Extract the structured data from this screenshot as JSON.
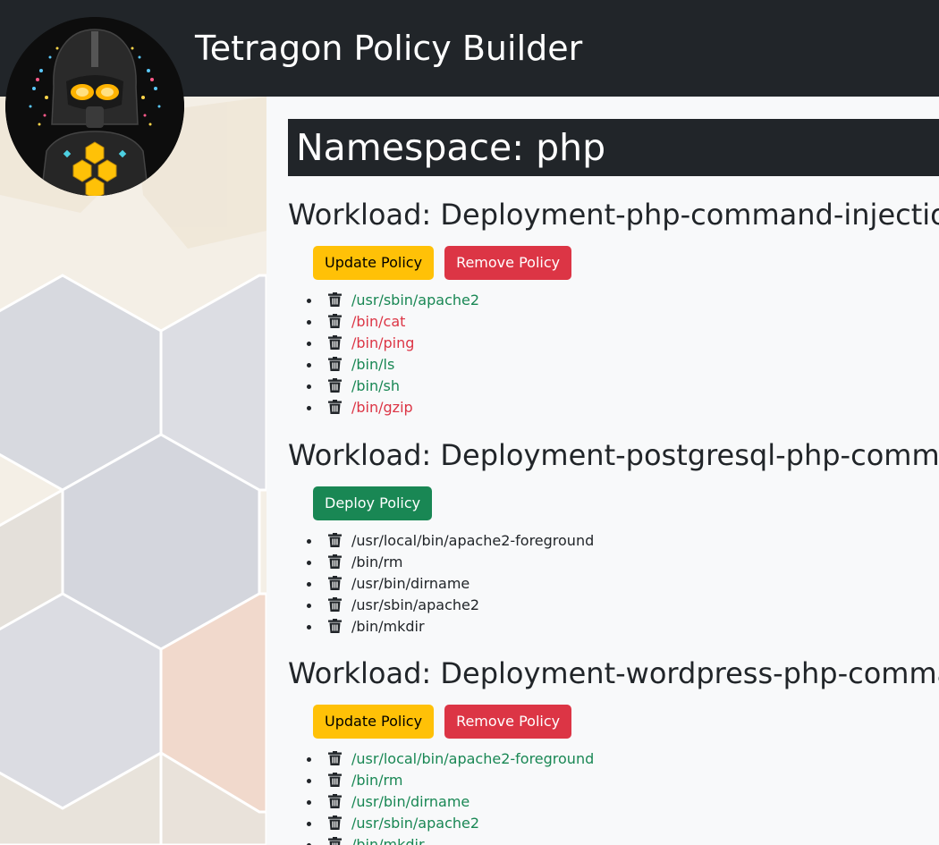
{
  "navbar": {
    "brand": "Tetragon Policy Builder"
  },
  "namespace": {
    "title": "Namespace: php"
  },
  "workloads": [
    {
      "title": "Workload: Deployment-php-command-injection",
      "buttons": [
        {
          "label": "Update Policy",
          "variant": "warning"
        },
        {
          "label": "Remove Policy",
          "variant": "danger"
        }
      ],
      "binaries": [
        {
          "path": "/usr/sbin/apache2",
          "status": "allowed"
        },
        {
          "path": "/bin/cat",
          "status": "blocked"
        },
        {
          "path": "/bin/ping",
          "status": "blocked"
        },
        {
          "path": "/bin/ls",
          "status": "allowed"
        },
        {
          "path": "/bin/sh",
          "status": "allowed"
        },
        {
          "path": "/bin/gzip",
          "status": "blocked"
        }
      ]
    },
    {
      "title": "Workload: Deployment-postgresql-php-command-injection",
      "buttons": [
        {
          "label": "Deploy Policy",
          "variant": "success"
        }
      ],
      "binaries": [
        {
          "path": "/usr/local/bin/apache2-foreground",
          "status": "none"
        },
        {
          "path": "/bin/rm",
          "status": "none"
        },
        {
          "path": "/usr/bin/dirname",
          "status": "none"
        },
        {
          "path": "/usr/sbin/apache2",
          "status": "none"
        },
        {
          "path": "/bin/mkdir",
          "status": "none"
        }
      ]
    },
    {
      "title": "Workload: Deployment-wordpress-php-command-injection",
      "buttons": [
        {
          "label": "Update Policy",
          "variant": "warning"
        },
        {
          "label": "Remove Policy",
          "variant": "danger"
        }
      ],
      "binaries": [
        {
          "path": "/usr/local/bin/apache2-foreground",
          "status": "allowed"
        },
        {
          "path": "/bin/rm",
          "status": "allowed"
        },
        {
          "path": "/usr/bin/dirname",
          "status": "allowed"
        },
        {
          "path": "/usr/sbin/apache2",
          "status": "allowed"
        },
        {
          "path": "/bin/mkdir",
          "status": "allowed"
        }
      ]
    }
  ],
  "colors": {
    "navbar_bg": "#212529",
    "allowed": "#198754",
    "blocked": "#dc3545",
    "warning": "#ffc107",
    "danger": "#dc3545",
    "success": "#198754"
  },
  "icons": {
    "list_item": "trash-icon",
    "logo": "hooded-figure-logo"
  }
}
